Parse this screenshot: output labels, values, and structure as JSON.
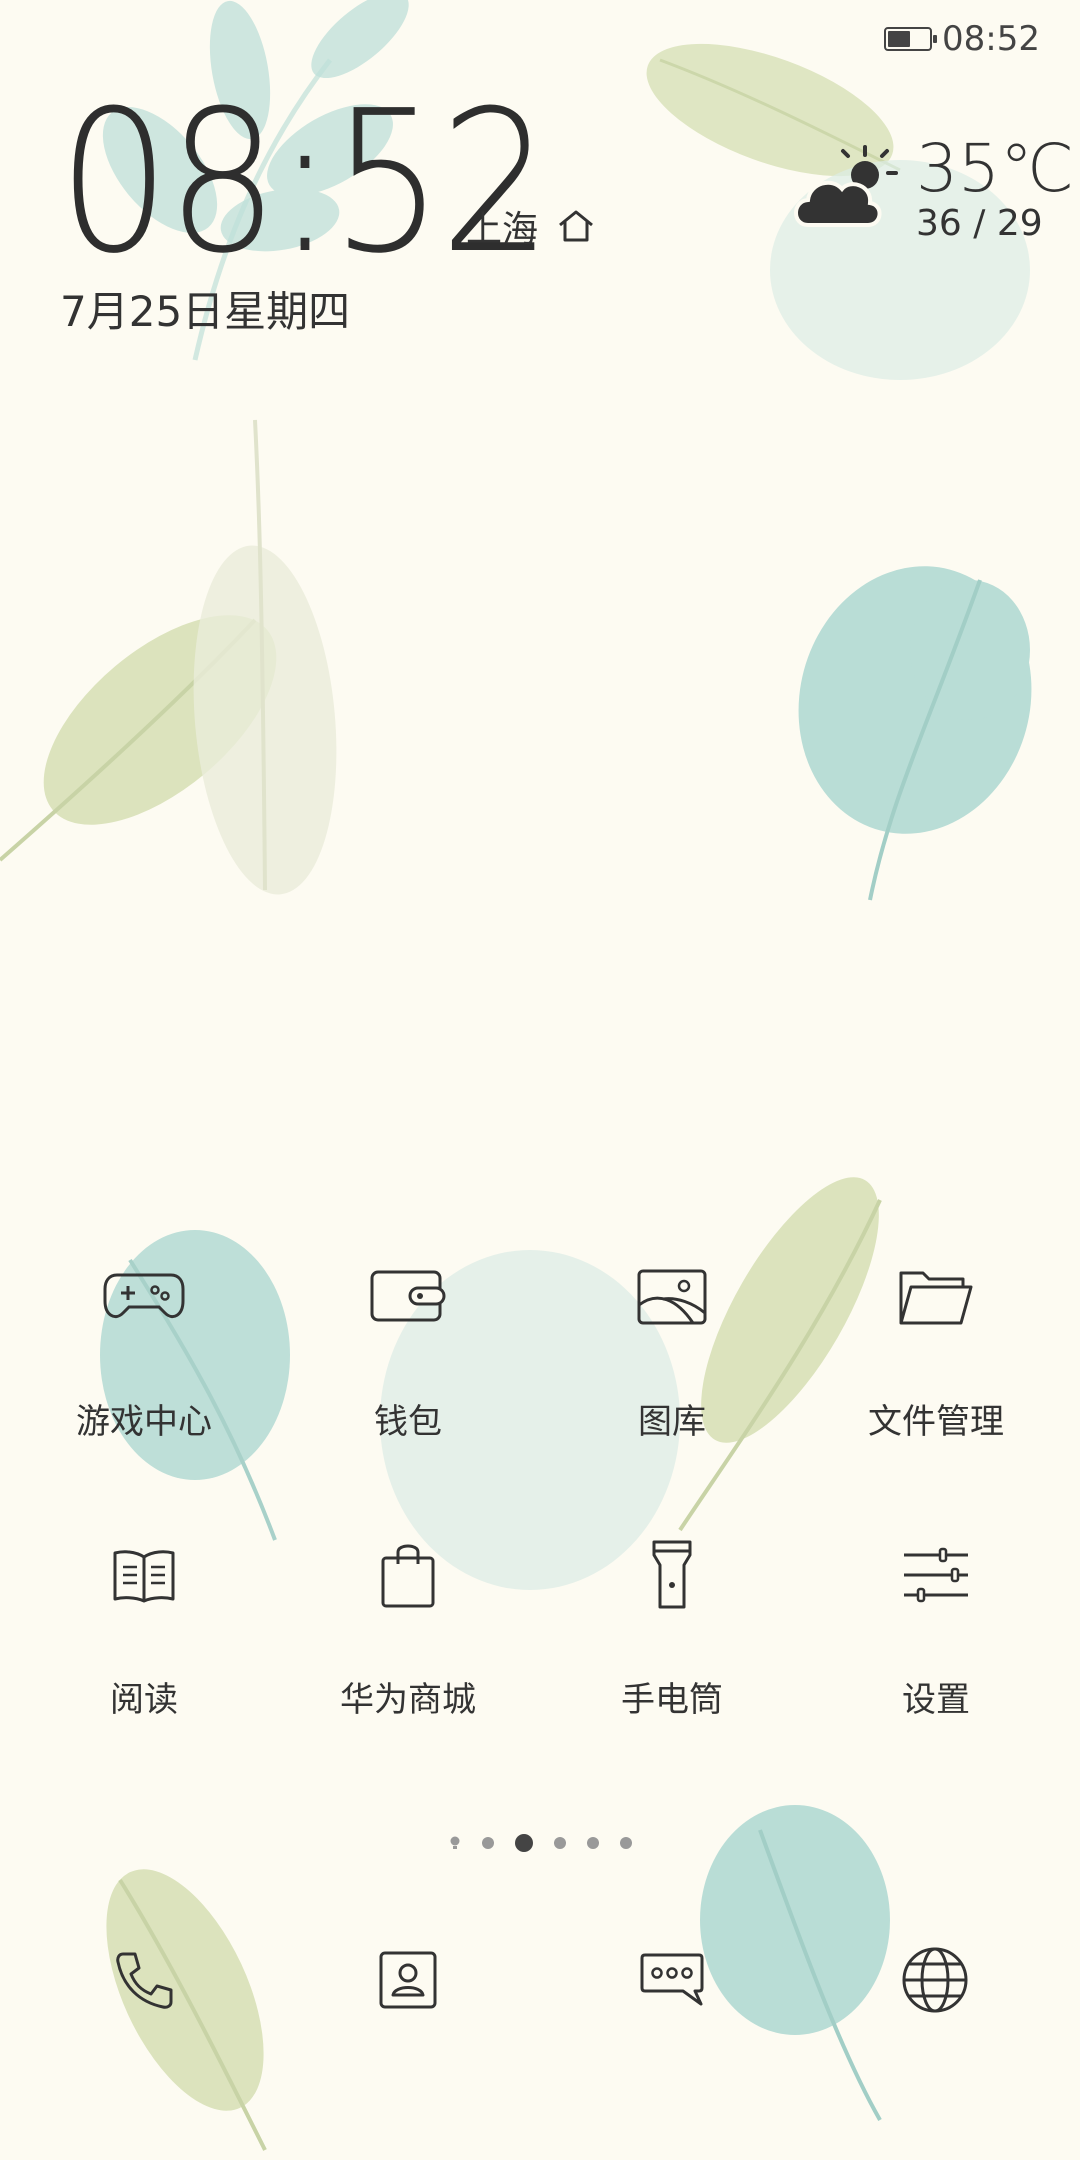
{
  "status_bar": {
    "time": "08:52",
    "battery_level": 0.55
  },
  "clock": {
    "time": "08:52",
    "city": "上海",
    "date": "7月25日星期四"
  },
  "weather": {
    "temperature": "35℃",
    "range": "36 / 29",
    "icon": "partly-cloudy-icon"
  },
  "apps": [
    {
      "label": "游戏中心",
      "icon": "gamepad-icon"
    },
    {
      "label": "钱包",
      "icon": "wallet-icon"
    },
    {
      "label": "图库",
      "icon": "gallery-icon"
    },
    {
      "label": "文件管理",
      "icon": "folder-icon"
    },
    {
      "label": "阅读",
      "icon": "book-icon"
    },
    {
      "label": "华为商城",
      "icon": "shopping-bag-icon"
    },
    {
      "label": "手电筒",
      "icon": "flashlight-icon"
    },
    {
      "label": "设置",
      "icon": "settings-sliders-icon"
    }
  ],
  "page_indicator": {
    "pages": 6,
    "current": 3
  },
  "dock": [
    {
      "icon": "phone-icon"
    },
    {
      "icon": "contacts-icon"
    },
    {
      "icon": "messages-icon"
    },
    {
      "icon": "browser-icon"
    }
  ],
  "colors": {
    "background": "#fdfbf2",
    "leaf_teal": "#a9d6d0",
    "leaf_green": "#cfdcae",
    "ink": "#333333"
  }
}
